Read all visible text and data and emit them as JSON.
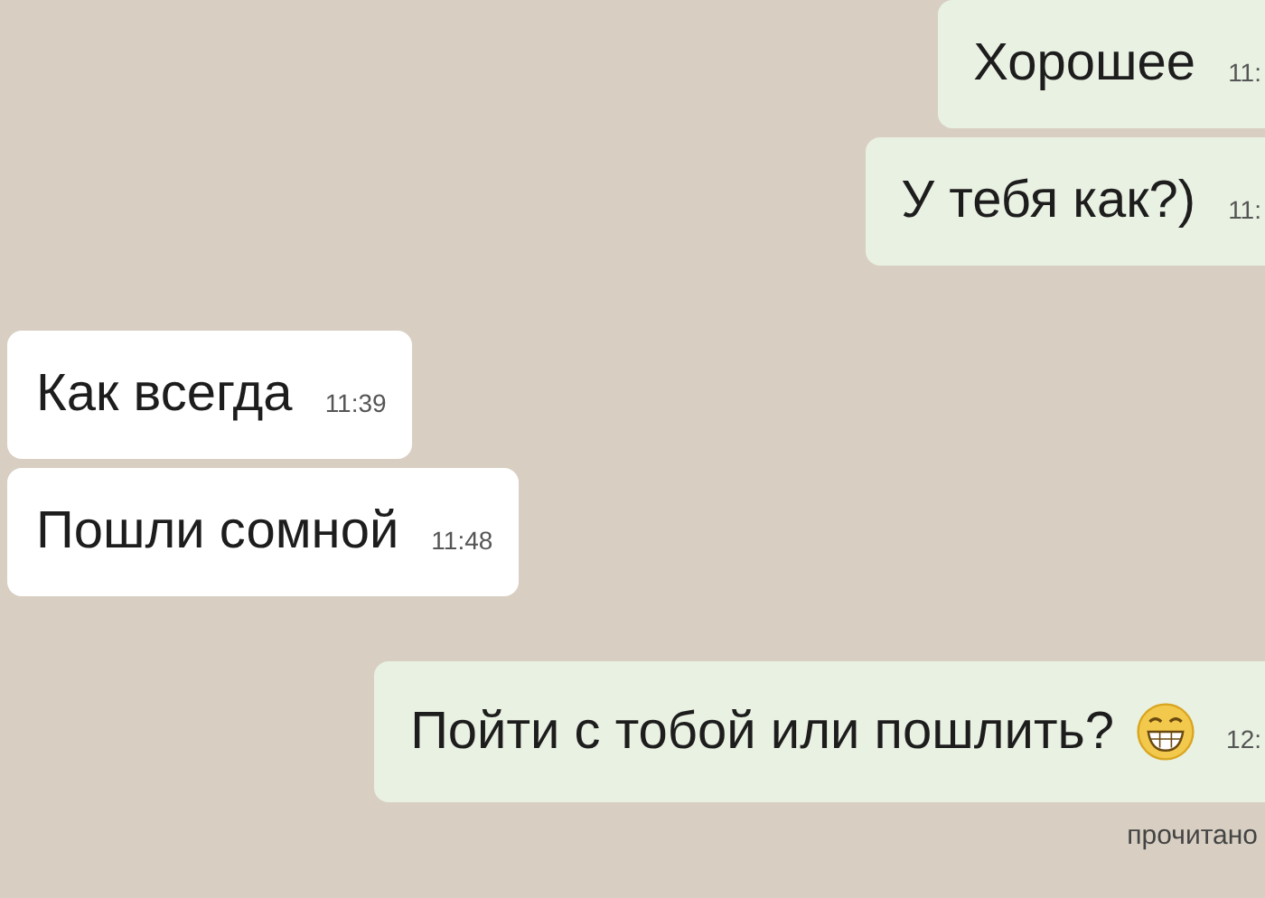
{
  "messages": [
    {
      "kind": "outgoing",
      "text": "Хорошее",
      "time": "11:",
      "emoji": false
    },
    {
      "kind": "outgoing",
      "text": "У тебя как?)",
      "time": "11:",
      "emoji": false
    },
    {
      "kind": "incoming",
      "text": "Как всегда",
      "time": "11:39",
      "emoji": false
    },
    {
      "kind": "incoming",
      "text": "Пошли сомной",
      "time": "11:48",
      "emoji": false
    },
    {
      "kind": "outgoing",
      "text": "Пойти с тобой или пошлить?",
      "time": "12:",
      "emoji": true
    }
  ],
  "receipt": "прочитано"
}
